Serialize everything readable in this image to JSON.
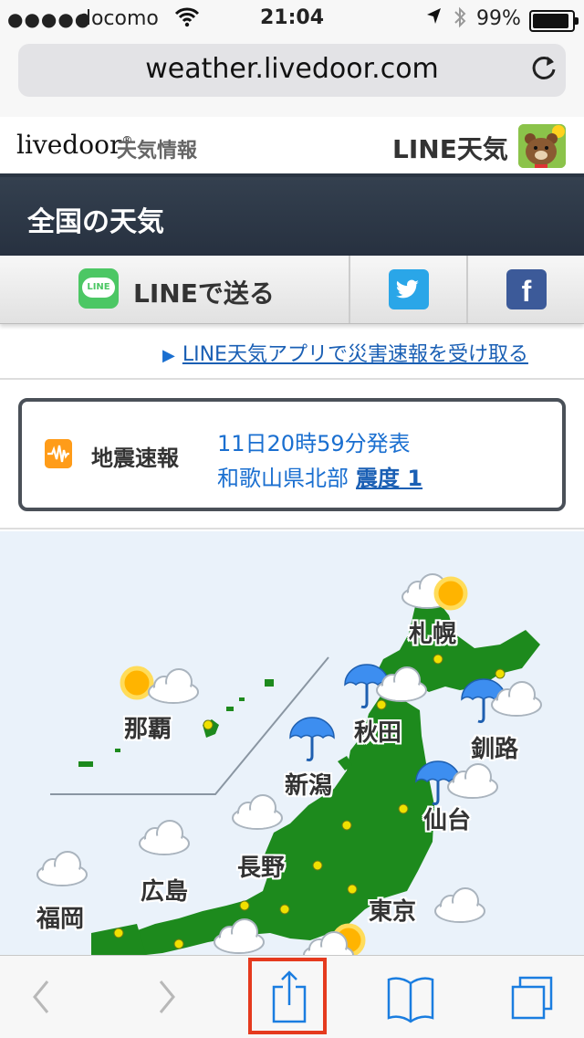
{
  "status_bar": {
    "signal": "●●●●●",
    "carrier": "docomo",
    "time": "21:04",
    "battery": "99%"
  },
  "browser": {
    "url": "weather.livedoor.com"
  },
  "site_header": {
    "logo": "livedoor",
    "logo_sup": "®",
    "logo_subtitle": "天気情報",
    "line_tenki": "LINE天気"
  },
  "section": {
    "title": "全国の天気"
  },
  "share": {
    "line_icon_text": "LINE",
    "line_label": "LINEで送る",
    "facebook_glyph": "f"
  },
  "app_link": {
    "text": "LINE天気アプリで災害速報を受け取る"
  },
  "earthquake": {
    "label": "地震速報",
    "announced": "11日20時59分発表",
    "region": "和歌山県北部",
    "intensity": "震度 1"
  },
  "map": {
    "cities": [
      {
        "name": "札幌",
        "weather": "sunny-cloudy"
      },
      {
        "name": "那覇",
        "weather": "sunny-cloudy"
      },
      {
        "name": "秋田",
        "weather": "rain-cloudy"
      },
      {
        "name": "釧路",
        "weather": "rain-cloudy"
      },
      {
        "name": "新潟",
        "weather": "rain"
      },
      {
        "name": "仙台",
        "weather": "rain-cloudy"
      },
      {
        "name": "長野",
        "weather": "cloudy"
      },
      {
        "name": "広島",
        "weather": "cloudy"
      },
      {
        "name": "福岡",
        "weather": "cloudy"
      },
      {
        "name": "東京",
        "weather": "cloudy"
      }
    ],
    "colors": {
      "sea": "#eaf2fa",
      "land": "#1d8a1d",
      "city_dot": "#f0e000"
    }
  },
  "toolbar": {
    "accent": "#1a7de0",
    "disabled": "#b8b8b8",
    "highlight": "#e53a1e"
  }
}
